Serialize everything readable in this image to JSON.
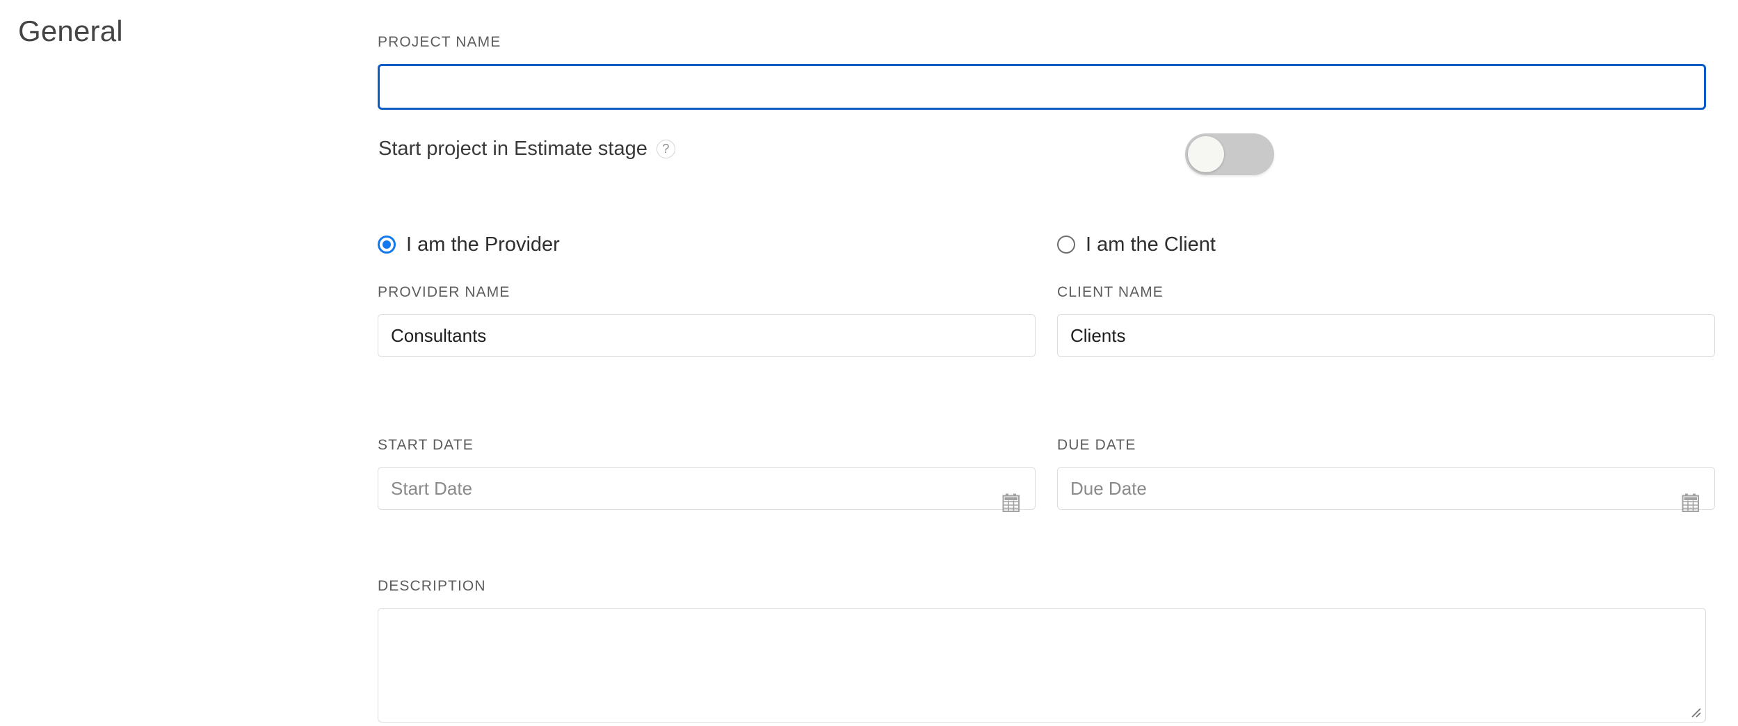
{
  "section": {
    "title": "General"
  },
  "project_name": {
    "label": "PROJECT NAME",
    "value": "",
    "placeholder": ""
  },
  "estimate_toggle": {
    "label": "Start project in Estimate stage",
    "help_icon": "question-mark-icon",
    "help_glyph": "?",
    "state": "off"
  },
  "role": {
    "options": [
      {
        "label": "I am the Provider",
        "selected": true
      },
      {
        "label": "I am the Client",
        "selected": false
      }
    ]
  },
  "provider_name": {
    "label": "PROVIDER NAME",
    "value": "Consultants",
    "placeholder": ""
  },
  "client_name": {
    "label": "CLIENT NAME",
    "value": "Clients",
    "placeholder": ""
  },
  "start_date": {
    "label": "START DATE",
    "value": "",
    "placeholder": "Start Date",
    "icon": "calendar-icon"
  },
  "due_date": {
    "label": "DUE DATE",
    "value": "",
    "placeholder": "Due Date",
    "icon": "calendar-icon"
  },
  "description": {
    "label": "DESCRIPTION",
    "value": "",
    "placeholder": ""
  },
  "colors": {
    "focus_border": "#0b5cc4",
    "radio_accent": "#1379f0",
    "toggle_track_off": "#c9c9c9",
    "toggle_knob": "#f6f6f3",
    "field_border": "#dcdcdc",
    "label_text": "#5d5d5d",
    "body_text": "#2e2e2e",
    "page_background": "#ffffff"
  }
}
